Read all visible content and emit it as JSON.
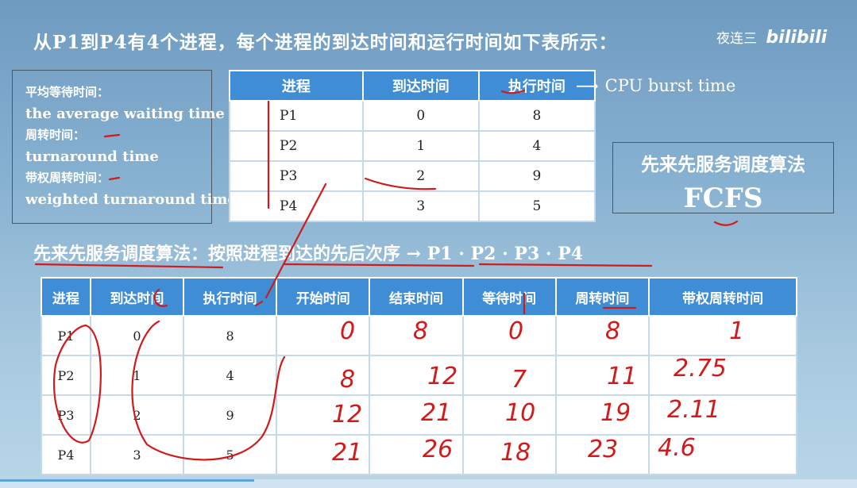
{
  "title": "从P1到P4有4个进程，每个进程的到达时间和运行时间如下表所示：",
  "watermark": {
    "author": "夜连三",
    "logo": "bilibili"
  },
  "terms": [
    {
      "zh": "平均等待时间：",
      "en": "the average waiting time"
    },
    {
      "zh": "周转时间：",
      "en": "turnaround time"
    },
    {
      "zh": "带权周转时间：",
      "en": "weighted turnaround time"
    }
  ],
  "table1": {
    "headers": [
      "进程",
      "到达时间",
      "执行时间"
    ],
    "rows": [
      [
        "P1",
        "0",
        "8"
      ],
      [
        "P2",
        "1",
        "4"
      ],
      [
        "P3",
        "2",
        "9"
      ],
      [
        "P4",
        "3",
        "5"
      ]
    ]
  },
  "cpu_note": {
    "arrow": "⟶",
    "text": "CPU burst time"
  },
  "fcfs": {
    "cn": "先来先服务调度算法",
    "en": "FCFS"
  },
  "subtitle": "先来先服务调度算法：按照进程到达的先后次序 → P1 · P2 · P3 · P4",
  "table2": {
    "headers": [
      "进程",
      "到达时间",
      "执行时间",
      "开始时间",
      "结束时间",
      "等待时间",
      "周转时间",
      "带权周转时间"
    ],
    "rows": [
      [
        "P1",
        "0",
        "8"
      ],
      [
        "P2",
        "1",
        "4"
      ],
      [
        "P3",
        "2",
        "9"
      ],
      [
        "P4",
        "3",
        "5"
      ]
    ]
  },
  "handwriting": {
    "color": "#d11a1a",
    "rows": [
      [
        "0",
        "8",
        "0",
        "8",
        "1"
      ],
      [
        "8",
        "12",
        "7",
        "11",
        "2.75"
      ],
      [
        "12",
        "21",
        "10",
        "19",
        "2.11"
      ],
      [
        "21",
        "26",
        "18",
        "23",
        "4.6"
      ]
    ]
  }
}
